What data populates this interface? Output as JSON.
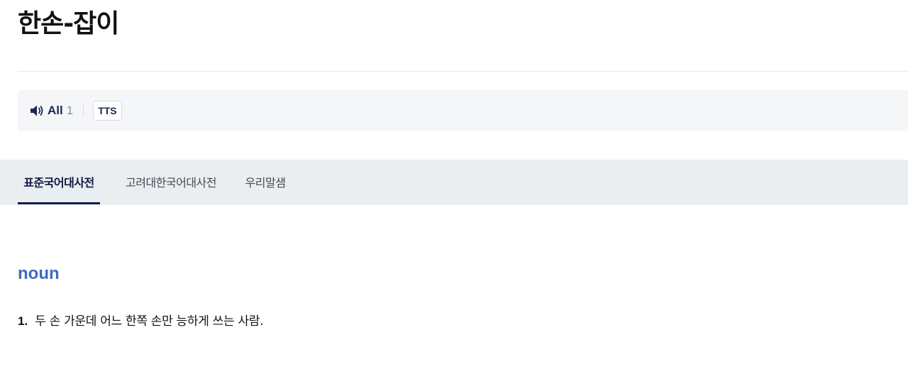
{
  "entry": {
    "headword": "한손-잡이"
  },
  "audio": {
    "all_label": "All",
    "all_count": "1",
    "tts_label": "TTS"
  },
  "tabs": [
    {
      "label": "표준국어대사전",
      "active": true
    },
    {
      "label": "고려대한국어대사전",
      "active": false
    },
    {
      "label": "우리말샘",
      "active": false
    }
  ],
  "sense": {
    "part_of_speech": "noun",
    "definitions": [
      {
        "number": "1.",
        "text": "두 손 가운데 어느 한쪽 손만 능하게 쓰는 사람."
      }
    ]
  },
  "colors": {
    "pos_blue": "#3d6bbf",
    "tab_active_navy": "#0d1b4f",
    "audio_bar_bg": "#f5f6f8",
    "tabs_bg": "#ebeef1"
  }
}
